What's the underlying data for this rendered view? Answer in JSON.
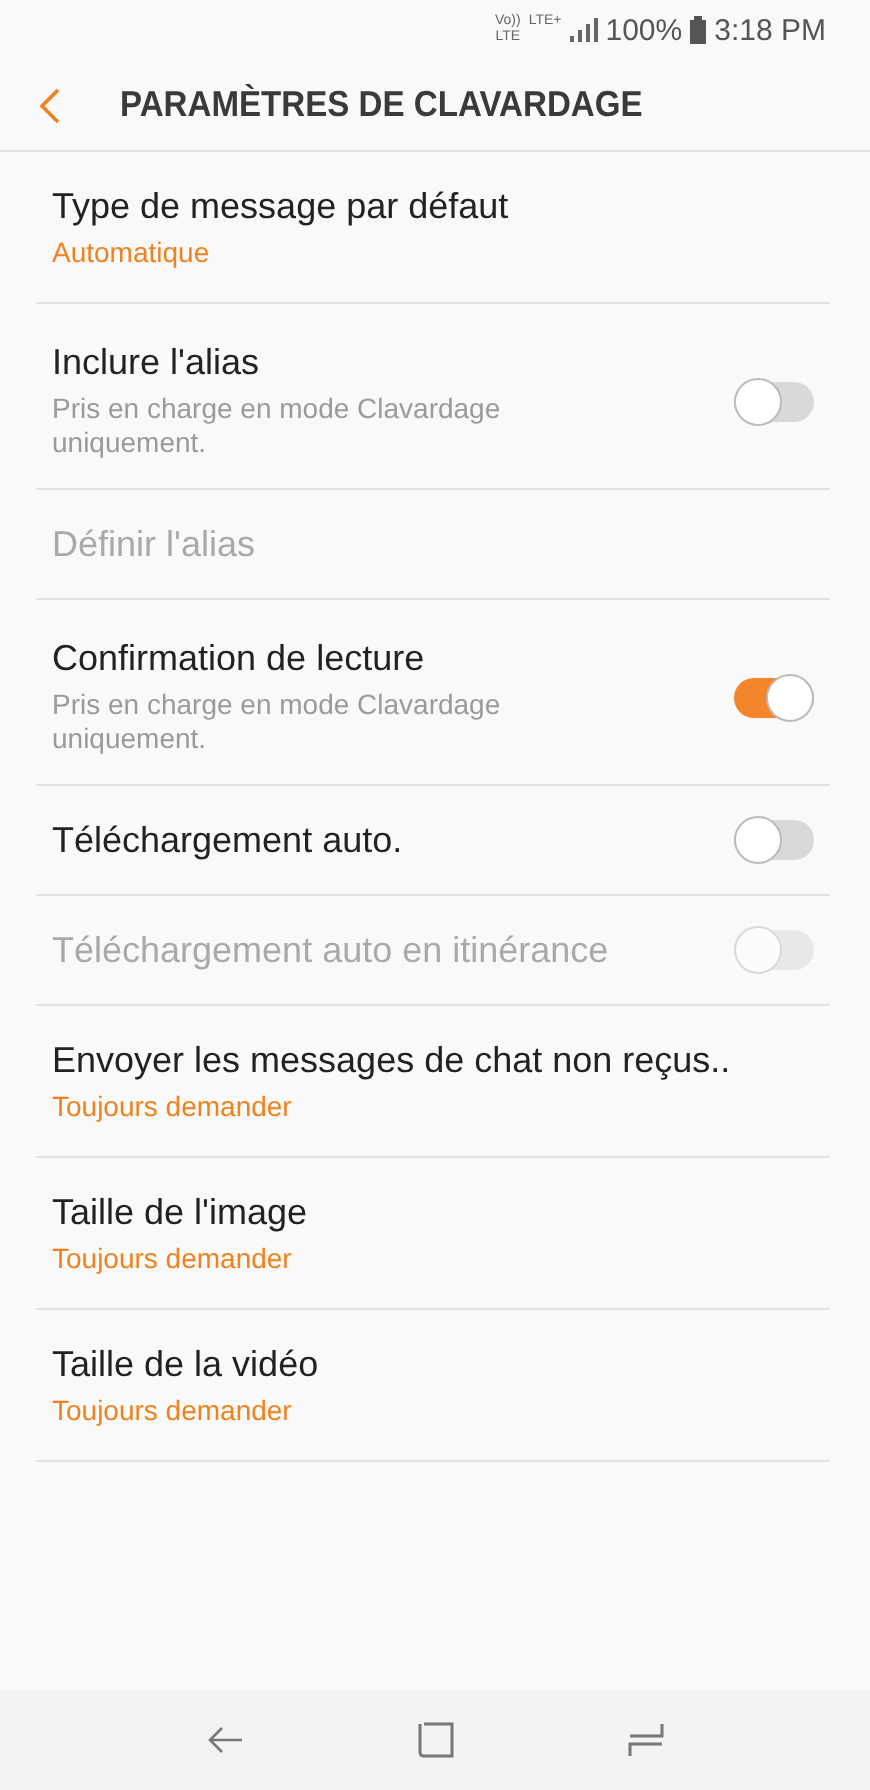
{
  "status_bar": {
    "volte": [
      "Vo))",
      "LTE"
    ],
    "network": "LTE+",
    "battery": "100%",
    "time": "3:18 PM"
  },
  "header": {
    "title": "PARAMÈTRES DE CLAVARDAGE"
  },
  "settings": [
    {
      "kind": "value",
      "title": "Type de message par défaut",
      "value": "Automatique",
      "disabled": false
    },
    {
      "kind": "switch",
      "title": "Inclure l'alias",
      "description": "Pris en charge en mode Clavardage uniquement.",
      "on": false,
      "disabled": false
    },
    {
      "kind": "plain",
      "title": "Définir l'alias",
      "disabled": true
    },
    {
      "kind": "switch",
      "title": "Confirmation de lecture",
      "description": "Pris en charge en mode Clavardage uniquement.",
      "on": true,
      "disabled": false
    },
    {
      "kind": "switch",
      "title": "Téléchargement auto.",
      "on": false,
      "disabled": false
    },
    {
      "kind": "switch",
      "title": "Téléchargement auto en itinérance",
      "on": false,
      "disabled": true
    },
    {
      "kind": "value",
      "title": "Envoyer les messages de chat non reçus..",
      "value": "Toujours demander",
      "disabled": false
    },
    {
      "kind": "value",
      "title": "Taille de l'image",
      "value": "Toujours demander",
      "disabled": false
    },
    {
      "kind": "value",
      "title": "Taille de la vidéo",
      "value": "Toujours demander",
      "disabled": false
    }
  ]
}
